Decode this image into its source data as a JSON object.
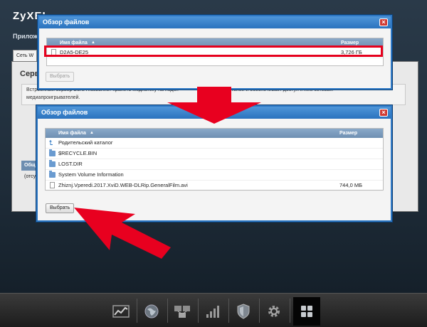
{
  "app": {
    "brand": "ZyXEL",
    "subtitle": "Прилож",
    "tab_label": "Сеть W",
    "section_title": "Серв",
    "description_line1": "Встроенный сервер DLNA позволяет хранить медиатеку на подкл",
    "description_line1b": "ателей и обеспечивает доступ к ним сетевых",
    "description_line2": "медиапроигрывателей.",
    "table_head": "Общ",
    "table_row": "(отсу"
  },
  "dialog_top": {
    "title": "Обзор файлов",
    "close": "×",
    "col_name": "Имя файла",
    "sort_indicator": "▲",
    "col_size": "Размер",
    "rows": [
      {
        "name": "D2A5-DE25",
        "size": "3,726 ГБ",
        "icon": "drive-icon"
      }
    ],
    "select_button": "Выбрать"
  },
  "dialog_bottom": {
    "title": "Обзор файлов",
    "close": "×",
    "col_name": "Имя файла",
    "sort_indicator": "▲",
    "col_size": "Размер",
    "rows": [
      {
        "name": "Родительский каталог",
        "size": "",
        "icon": "parent-folder-icon"
      },
      {
        "name": "$RECYCLE.BIN",
        "size": "",
        "icon": "folder-icon"
      },
      {
        "name": "LOST.DIR",
        "size": "",
        "icon": "folder-icon"
      },
      {
        "name": "System Volume Information",
        "size": "",
        "icon": "folder-icon"
      },
      {
        "name": "Zhiznj.Vperedi.2017.XviD.WEB-DLRip.GeneralFilm.avi",
        "size": "744,0 МБ",
        "icon": "file-icon"
      }
    ],
    "select_button": "Выбрать"
  },
  "taskbar": [
    {
      "name": "dashboard-chart-icon"
    },
    {
      "name": "internet-globe-icon"
    },
    {
      "name": "home-network-icon"
    },
    {
      "name": "wifi-signal-icon"
    },
    {
      "name": "security-shield-icon"
    },
    {
      "name": "settings-gear-icon"
    },
    {
      "name": "applications-grid-icon",
      "active": true
    }
  ],
  "colors": {
    "dialog_border": "#2e78c4",
    "highlight": "#e5001d",
    "arrow": "#e8001f"
  }
}
